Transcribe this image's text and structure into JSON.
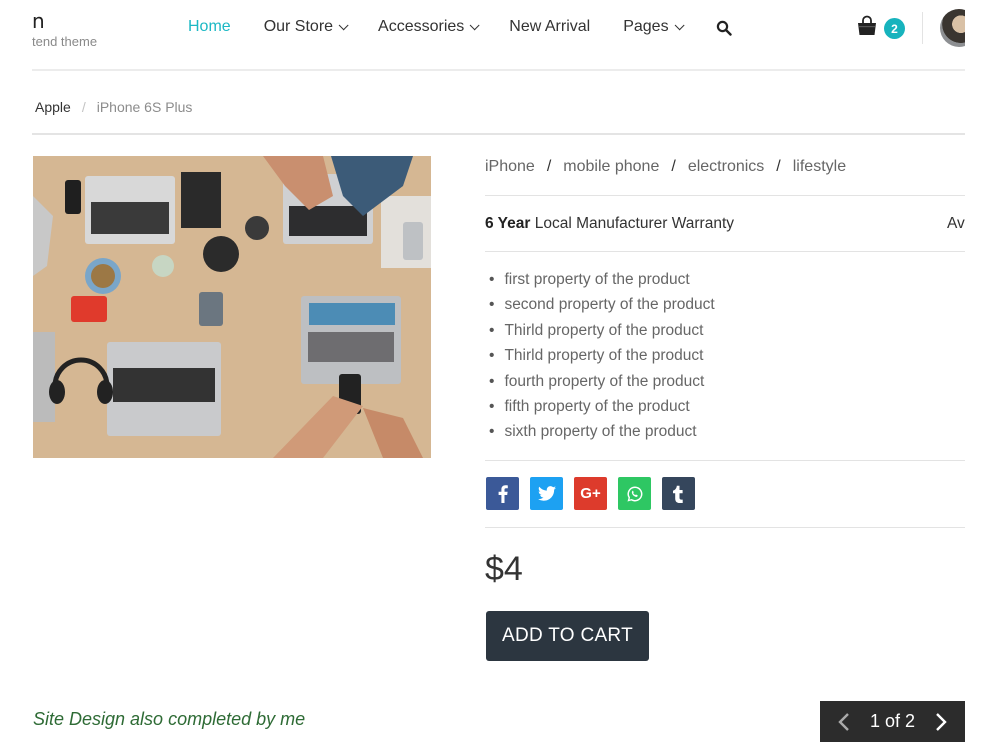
{
  "header": {
    "brand_name": "n",
    "brand_tagline": "tend theme",
    "nav": [
      {
        "label": "Home",
        "dropdown": false,
        "active": true
      },
      {
        "label": "Our Store",
        "dropdown": true,
        "active": false
      },
      {
        "label": "Accessories",
        "dropdown": true,
        "active": false
      },
      {
        "label": "New Arrival",
        "dropdown": false,
        "active": false
      },
      {
        "label": "Pages",
        "dropdown": true,
        "active": false
      }
    ],
    "search_icon": "search-icon",
    "cart_icon": "shopping-bag-icon",
    "cart_count": "2"
  },
  "breadcrumb": {
    "parent": "Apple",
    "separator": "/",
    "current": "iPhone 6S Plus"
  },
  "product": {
    "tags": [
      "iPhone",
      "mobile phone",
      "electronics",
      "lifestyle"
    ],
    "tag_separator": "/",
    "warranty_bold": "6 Year",
    "warranty_text": " Local Manufacturer Warranty",
    "availability_partial": "Av",
    "properties": [
      "first property of the product",
      "second property of the product",
      "Thirld property of the product",
      "Thirld property of the product",
      "fourth property of the product",
      "fifth property of the product",
      "sixth property of the product"
    ],
    "share": [
      {
        "name": "facebook",
        "glyph": "f",
        "color": "#3b5998"
      },
      {
        "name": "twitter",
        "glyph": "t",
        "color": "#1da1f2"
      },
      {
        "name": "google-plus",
        "glyph": "G+",
        "color": "#dd3b2c"
      },
      {
        "name": "whatsapp",
        "glyph": "w",
        "color": "#2ec763"
      },
      {
        "name": "tumblr",
        "glyph": "t",
        "color": "#35465c"
      }
    ],
    "price": "$4",
    "add_to_cart": "ADD TO CART"
  },
  "footer": {
    "note": "Site Design also completed by me",
    "pager_text": "1 of 2"
  },
  "colors": {
    "accent": "#1cb8c4",
    "dark": "#2c3640",
    "footer_note": "#2e6b35"
  }
}
